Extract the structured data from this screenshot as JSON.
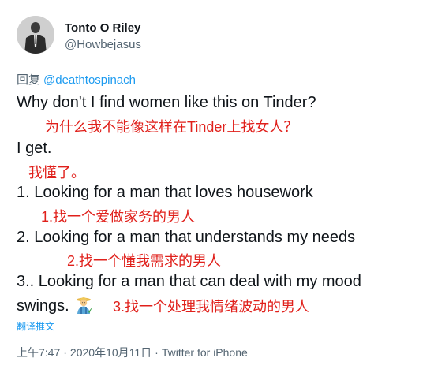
{
  "author": {
    "display_name": "Tonto O Riley",
    "handle": "@Howbejasus",
    "avatar_icon": "avatar-figure-in-suit"
  },
  "reply": {
    "prefix": "回复",
    "mention": "@deathtospinach"
  },
  "tweet": {
    "line1": "Why don't I find women like this on Tinder?",
    "anno1": "为什么我不能像这样在Tinder上找女人？",
    "line2": "I get.",
    "anno2": "我懂了。",
    "line3": "1. Looking for a man that loves housework",
    "anno3": "1.找一个爱做家务的男人",
    "line4": "2. Looking for a man that understands my needs",
    "anno4": "2.找一个懂我需求的男人",
    "line5": "3.. Looking for a man that can deal with my mood",
    "line6": "swings.",
    "emoji_icon": "man-farmer-emoji",
    "anno5": "3.找一个处理我情绪波动的男人"
  },
  "translate_label": "翻译推文",
  "meta": {
    "time": "上午7:47",
    "separator": "·",
    "date": "2020年10月11日",
    "source": "Twitter for iPhone"
  },
  "colors": {
    "text": "#0f1419",
    "secondary": "#536471",
    "link": "#1d9bf0",
    "annotation": "#e0201b"
  }
}
